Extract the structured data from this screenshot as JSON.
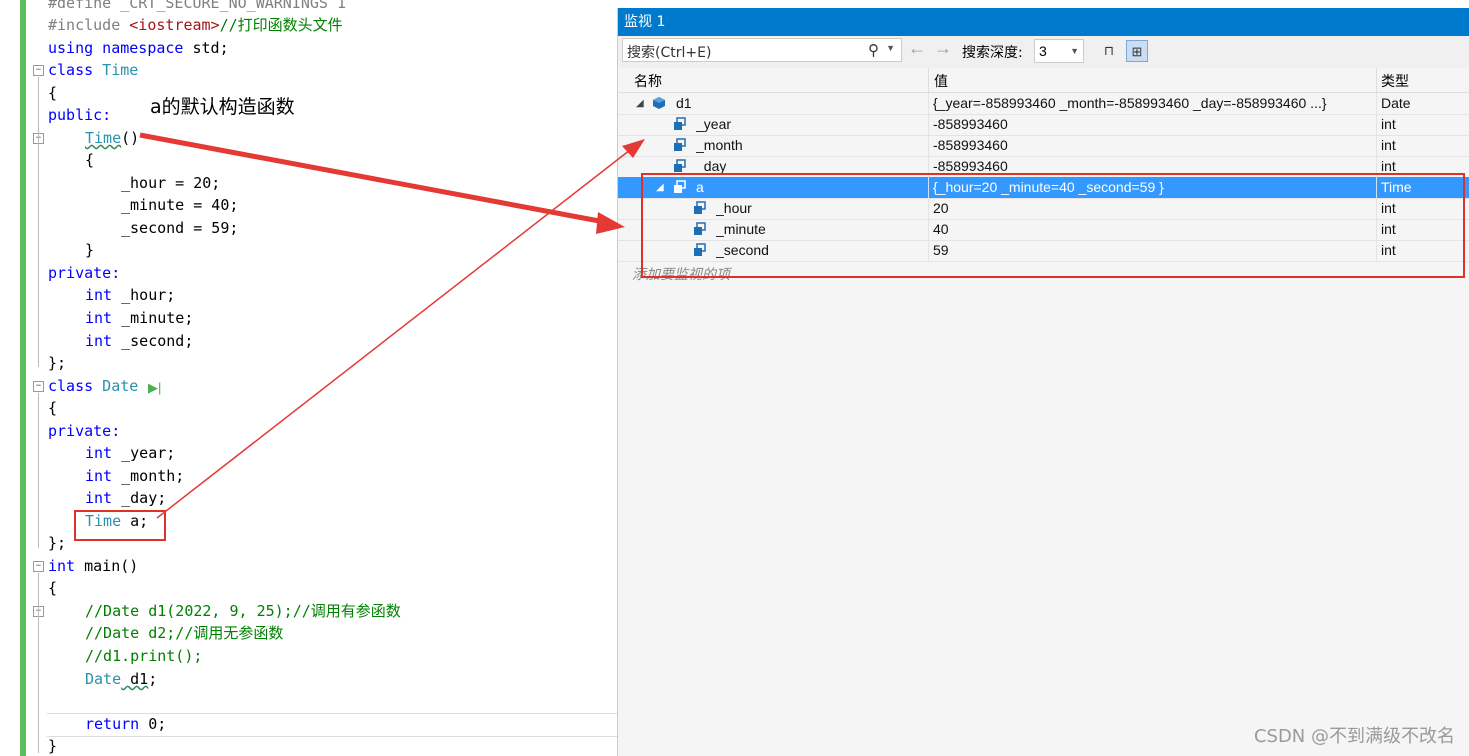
{
  "editor": {
    "annotation": "a的默认构造函数",
    "lines": {
      "l0": "#define _CRT_SECURE_NO_WARNINGS 1",
      "l1a": "#include ",
      "l1b": "<iostream>",
      "l1c": "//打印函数头文件",
      "l2a": "using",
      "l2b": " namespace",
      "l2c": " std;",
      "l3a": "class",
      "l3b": " Time",
      "l4": "{",
      "l5": "public:",
      "l6a": "Time",
      "l6b": "()",
      "l7": "{",
      "l8": "_hour = 20;",
      "l9": "_minute = 40;",
      "l10": "_second = 59;",
      "l11": "}",
      "l12": "private:",
      "l13a": "int",
      "l13b": " _hour;",
      "l14a": "int",
      "l14b": " _minute;",
      "l15a": "int",
      "l15b": " _second;",
      "l16": "};",
      "l17a": "class",
      "l17b": " Date",
      "l18": "{",
      "l19": "private:",
      "l20a": "int",
      "l20b": " _year;",
      "l21a": "int",
      "l21b": " _month;",
      "l22a": "int",
      "l22b": " _day;",
      "l23a": "Time",
      "l23b": " a;",
      "l24": "};",
      "l25a": "int",
      "l25b": " main()",
      "l26": "{",
      "l27": "//Date d1(2022, 9, 25);//调用有参函数",
      "l28": "//Date d2;//调用无参函数",
      "l29": "//d1.print();",
      "l30a": "Date",
      "l30b": " d1",
      "l30c": ";",
      "l31a": "return",
      "l31b": " 0;",
      "l32": "}"
    }
  },
  "watch": {
    "title": "监视 1",
    "search_placeholder": "搜索(Ctrl+E)",
    "depth_label": "搜索深度:",
    "depth_value": "3",
    "columns": {
      "name": "名称",
      "value": "值",
      "type": "类型"
    },
    "rows": [
      {
        "name": "d1",
        "value": "{_year=-858993460 _month=-858993460 _day=-858993460 ...}",
        "type": "Date"
      },
      {
        "name": "_year",
        "value": "-858993460",
        "type": "int"
      },
      {
        "name": "_month",
        "value": "-858993460",
        "type": "int"
      },
      {
        "name": "_day",
        "value": "-858993460",
        "type": "int"
      },
      {
        "name": "a",
        "value": "{_hour=20 _minute=40 _second=59 }",
        "type": "Time"
      },
      {
        "name": "_hour",
        "value": "20",
        "type": "int"
      },
      {
        "name": "_minute",
        "value": "40",
        "type": "int"
      },
      {
        "name": "_second",
        "value": "59",
        "type": "int"
      }
    ],
    "add_item": "添加要监视的项"
  },
  "watermark": "CSDN @不到满级不改名",
  "colors": {
    "title_bar": "#007acc",
    "selection": "#3399ff",
    "highlight_box": "#e0302a",
    "gutter": "#5cbf5c"
  }
}
